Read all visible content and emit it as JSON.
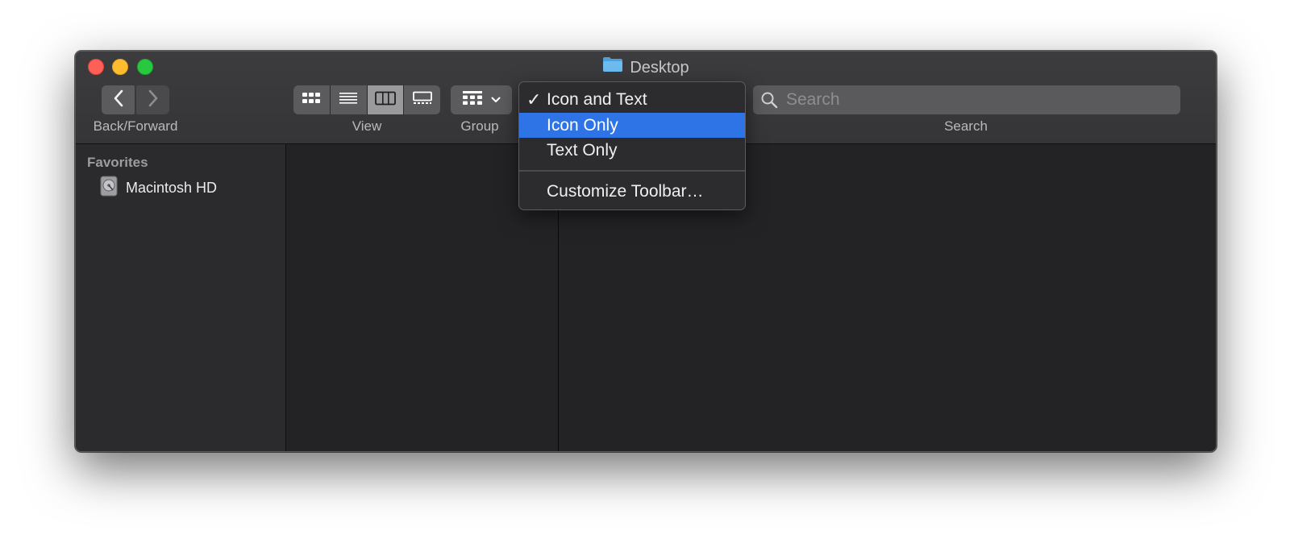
{
  "window": {
    "title": "Desktop",
    "title_icon": "folder-icon"
  },
  "toolbar": {
    "back_forward_label": "Back/Forward",
    "view_label": "View",
    "group_label": "Group",
    "search_label": "Search",
    "search_placeholder": "Search",
    "view_modes": [
      "icon-view-icon",
      "list-view-icon",
      "column-view-icon",
      "gallery-view-icon"
    ],
    "active_view": "column-view-icon"
  },
  "sidebar": {
    "section": "Favorites",
    "items": [
      {
        "label": "Macintosh HD",
        "icon": "hard-disk-icon"
      }
    ]
  },
  "context_menu": {
    "items": [
      {
        "label": "Icon and Text",
        "checked": true,
        "highlighted": false
      },
      {
        "label": "Icon Only",
        "checked": false,
        "highlighted": true
      },
      {
        "label": "Text Only",
        "checked": false,
        "highlighted": false
      },
      {
        "label": "Customize Toolbar…",
        "checked": false,
        "highlighted": false
      }
    ],
    "check_glyph": "✓"
  },
  "colors": {
    "highlight": "#2f74e6",
    "close": "#fe5f57",
    "minimize": "#febc2e",
    "maximize": "#28c840",
    "folder": "#5aaee8"
  }
}
